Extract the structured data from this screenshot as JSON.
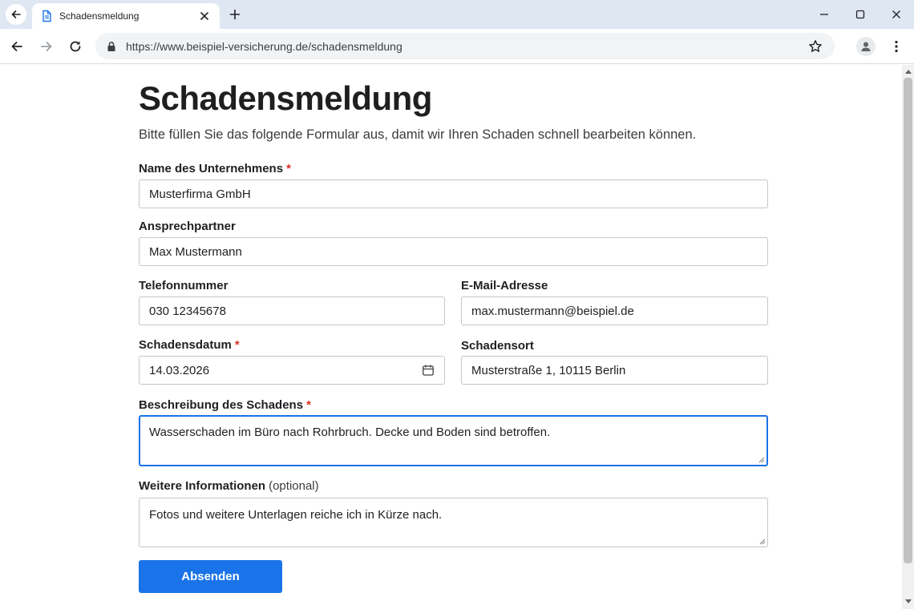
{
  "browser": {
    "tab_title": "Schadensmeldung",
    "url": "https://www.beispiel-versicherung.de/schadensmeldung",
    "icons": [
      "back-icon",
      "document-icon",
      "close-icon",
      "plus-icon",
      "minimize-icon",
      "maximize-icon",
      "forward-icon",
      "reload-icon",
      "lock-icon",
      "star-icon",
      "profile-icon",
      "kebab-menu-icon"
    ]
  },
  "form": {
    "title": "Schadensmeldung",
    "intro": "Bitte füllen Sie das folgende Formular aus, damit wir Ihren Schaden schnell bearbeiten können.",
    "required_mark": "*",
    "company": {
      "label": "Name des Unternehmens",
      "value": "Musterfirma GmbH"
    },
    "contact": {
      "label": "Ansprechpartner",
      "value": "Max Mustermann"
    },
    "phone": {
      "label": "Telefonnummer",
      "value": "030 12345678"
    },
    "email": {
      "label": "E-Mail-Adresse",
      "value": "max.mustermann@beispiel.de"
    },
    "damage_date": {
      "label": "Schadensdatum",
      "value": "14.03.2026"
    },
    "damage_location": {
      "label": "Schadensort",
      "value": "Musterstraße 1, 10115 Berlin"
    },
    "description": {
      "label": "Beschreibung des Schadens",
      "value": "Wasserschaden im Büro nach Rohrbruch. Decke und Boden sind betroffen."
    },
    "additional": {
      "label": "Weitere Informationen",
      "optional": "(optional)",
      "value": "Fotos und weitere Unterlagen reiche ich in Kürze nach."
    },
    "submit_label": "Absenden"
  },
  "colors": {
    "accent": "#1a73e8",
    "required": "#d93025",
    "tabstrip": "#dfe7f3"
  }
}
